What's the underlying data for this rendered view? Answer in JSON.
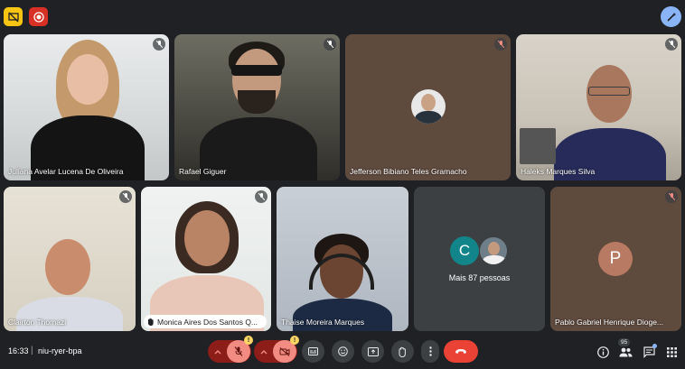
{
  "top": {
    "left_icons": [
      "presentation-off-icon",
      "record-icon"
    ],
    "right_icon": "magic-pen-icon"
  },
  "participants": [
    {
      "name": "Juliana Avelar Lucena De Oliveira",
      "muted": true
    },
    {
      "name": "Rafael Giguer",
      "muted": true
    },
    {
      "name": "Jefferson Bibiano Teles Gramacho",
      "muted": true
    },
    {
      "name": "Haleks Marques Silva",
      "muted": true
    },
    {
      "name": "Clairton Thomazi",
      "muted": true
    },
    {
      "name": "Monica Aires Dos Santos Q...",
      "muted": true
    },
    {
      "name": "Thaise Moreira Marques",
      "muted": false
    },
    {
      "name": "Pablo Gabriel Henrique Dioge...",
      "muted": true,
      "initial": "P"
    }
  ],
  "more_tile": {
    "initial": "C",
    "label": "Mais 87 pessoas"
  },
  "bottom": {
    "time": "16:33",
    "separator": "|",
    "meeting_code": "niu-ryer-bpa",
    "people_count": "95",
    "warning_mark": "!"
  },
  "colors": {
    "background": "#202124",
    "hangup": "#ea4335",
    "muted_pair": "#8c1d18",
    "avatar_p": "#b87a63",
    "avatar_c": "#12858a"
  }
}
